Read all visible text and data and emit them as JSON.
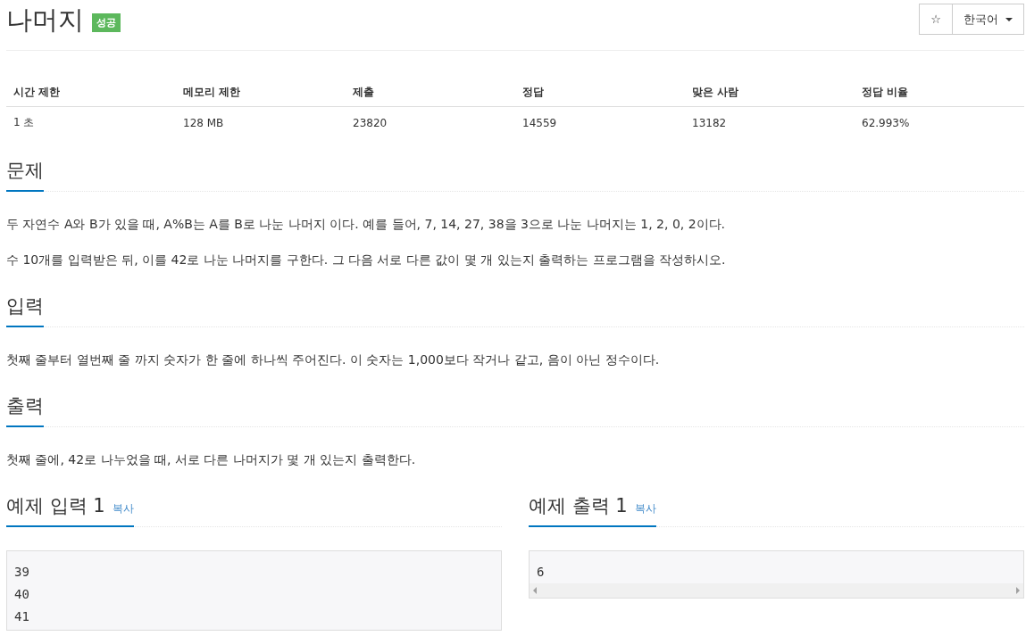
{
  "title": "나머지",
  "badge": "성공",
  "star_button": "☆",
  "language": {
    "label": "한국어"
  },
  "stats": {
    "columns": [
      "시간 제한",
      "메모리 제한",
      "제출",
      "정답",
      "맞은 사람",
      "정답 비율"
    ],
    "rows": [
      [
        "1 초",
        "128 MB",
        "23820",
        "14559",
        "13182",
        "62.993%"
      ]
    ]
  },
  "sections": [
    {
      "heading": "문제",
      "paragraphs": [
        "두 자연수 A와 B가 있을 때, A%B는 A를 B로 나눈 나머지 이다. 예를 들어, 7, 14, 27, 38을 3으로 나눈 나머지는 1, 2, 0, 2이다.",
        "수 10개를 입력받은 뒤, 이를 42로 나눈 나머지를 구한다. 그 다음 서로 다른 값이 몇 개 있는지 출력하는 프로그램을 작성하시오."
      ]
    },
    {
      "heading": "입력",
      "paragraphs": [
        "첫째 줄부터 열번째 줄 까지 숫자가 한 줄에 하나씩 주어진다. 이 숫자는 1,000보다 작거나 같고, 음이 아닌 정수이다."
      ]
    },
    {
      "heading": "출력",
      "paragraphs": [
        "첫째 줄에, 42로 나누었을 때, 서로 다른 나머지가 몇 개 있는지 출력한다."
      ]
    }
  ],
  "samples": [
    {
      "heading": "예제 입력 1",
      "copy": "복사",
      "lines": [
        "39",
        "40",
        "41"
      ]
    },
    {
      "heading": "예제 출력 1",
      "copy": "복사",
      "lines": [
        "6"
      ],
      "scrollbar": true
    }
  ]
}
